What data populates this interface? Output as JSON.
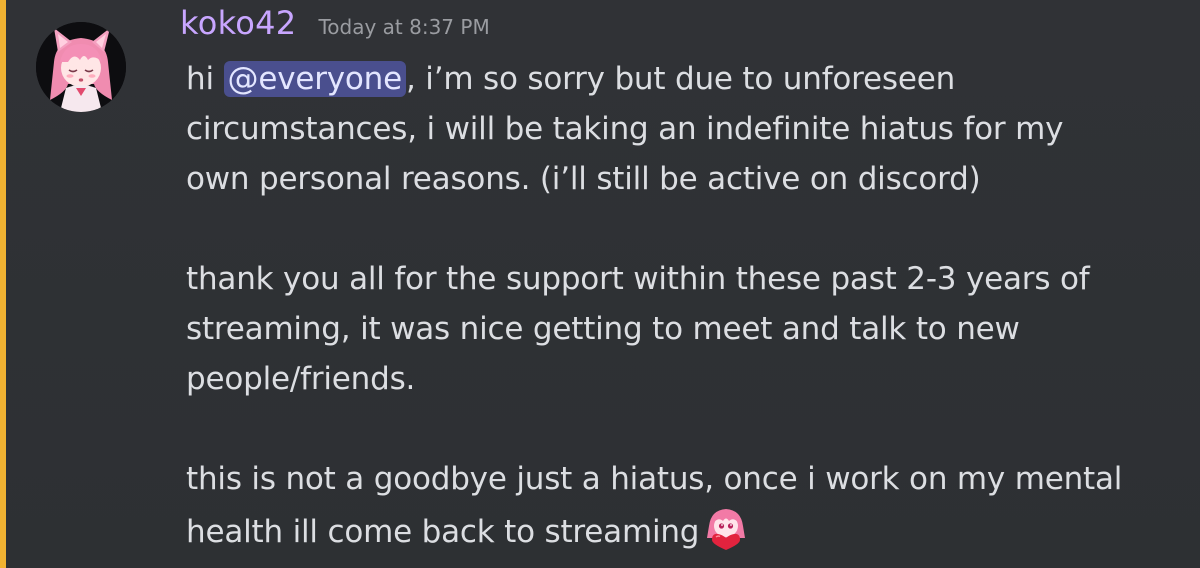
{
  "message": {
    "username": "koko42",
    "timestamp": "Today at 8:37 PM",
    "paragraph1": {
      "prefix": "hi ",
      "mention": "@everyone",
      "line1_rest": ", i’m so sorry but due to unforeseen",
      "line2": "circumstances, i will be taking an indefinite hiatus for my",
      "line3": "own personal reasons. (i’ll still be active on discord)"
    },
    "paragraph2": {
      "line1": "thank you all for the support within these past 2-3 years of",
      "line2": "streaming, it was nice getting to meet and talk to new",
      "line3": "people/friends."
    },
    "paragraph3": {
      "line1": "this is not a goodbye just a hiatus, once i work on my mental",
      "line2": "health ill come back to streaming"
    },
    "emoji": "pink-haired-girl-heart-emoji",
    "avatar": "pink-cat-girl-avatar"
  },
  "colors": {
    "mention_bar": "#f0b232",
    "username": "#c8a6ff",
    "mention_bg": "#4a4f8e",
    "background": "#2e3134"
  }
}
